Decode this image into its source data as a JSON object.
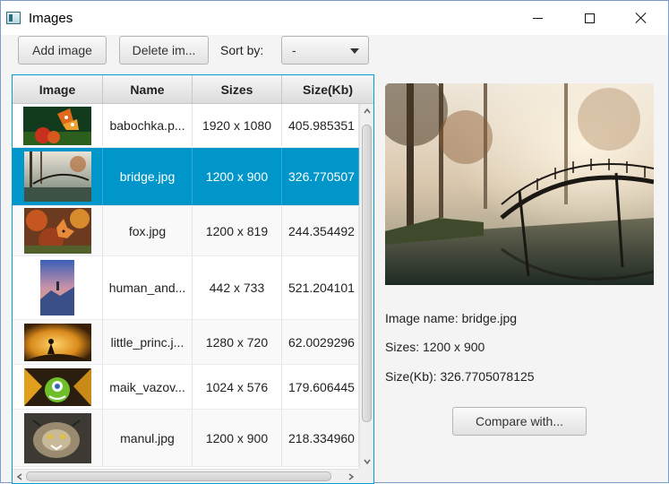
{
  "window": {
    "title": "Images",
    "controls": [
      "minimize",
      "maximize",
      "close"
    ]
  },
  "toolbar": {
    "add_label": "Add image",
    "delete_label": "Delete im...",
    "sort_label": "Sort by:",
    "sort_value": "-"
  },
  "table": {
    "headers": [
      "Image",
      "Name",
      "Sizes",
      "Size(Kb)"
    ],
    "rows": [
      {
        "name": "babochka.p...",
        "sizes": "1920 x 1080",
        "kb": "405.985351",
        "thumb": "butterfly"
      },
      {
        "name": "bridge.jpg",
        "sizes": "1200 x 900",
        "kb": "326.770507",
        "thumb": "bridge"
      },
      {
        "name": "fox.jpg",
        "sizes": "1200 x 819",
        "kb": "244.354492",
        "thumb": "fox"
      },
      {
        "name": "human_and...",
        "sizes": "442 x 733",
        "kb": "521.204101",
        "thumb": "human"
      },
      {
        "name": "little_princ.j...",
        "sizes": "1280 x 720",
        "kb": "62.0029296",
        "thumb": "prince"
      },
      {
        "name": "maik_vazov...",
        "sizes": "1024 x 576",
        "kb": "179.606445",
        "thumb": "monster"
      },
      {
        "name": "manul.jpg",
        "sizes": "1200 x 900",
        "kb": "218.334960",
        "thumb": "manul"
      }
    ],
    "selected_index": 1
  },
  "details": {
    "image_name": "Image name: bridge.jpg",
    "sizes": "Sizes: 1200 x 900",
    "size_kb": "Size(Kb): 326.7705078125",
    "compare_label": "Compare with..."
  },
  "colors": {
    "selection": "#0096c9",
    "table_border": "#039ed3"
  }
}
